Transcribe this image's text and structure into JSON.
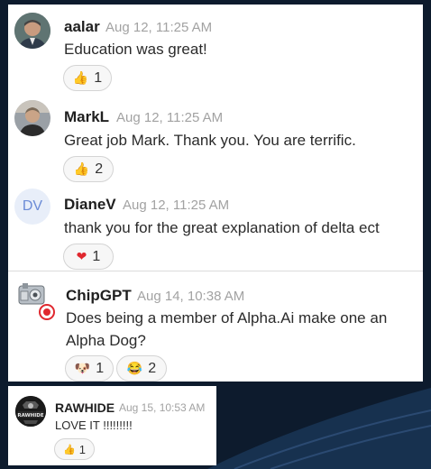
{
  "messages": [
    {
      "author": "aalar",
      "time": "Aug 12, 11:25 AM",
      "text": "Education was great!",
      "reactions": [
        {
          "icon": "thumbs-up",
          "count": "1"
        }
      ]
    },
    {
      "author": "MarkL",
      "time": "Aug 12, 11:25 AM",
      "text": "Great job Mark. Thank you. You are terrific.",
      "reactions": [
        {
          "icon": "thumbs-up",
          "count": "2"
        }
      ]
    },
    {
      "author": "DianeV",
      "initials": "DV",
      "time": "Aug 12, 11:25 AM",
      "text": "thank you for the great explanation of delta ect",
      "reactions": [
        {
          "icon": "red-heart",
          "count": "1"
        }
      ]
    },
    {
      "author": "ChipGPT",
      "time": "Aug 14, 10:38 AM",
      "text_line1": "Does being a member of Alpha.Ai make one an",
      "text_line2": "Alpha Dog?",
      "reactions": [
        {
          "icon": "dog-face",
          "count": "1"
        },
        {
          "icon": "joy-face",
          "count": "2"
        }
      ]
    },
    {
      "author": "RAWHIDE",
      "avatar_text": "RAWHIDE",
      "time": "Aug 15, 10:53 AM",
      "text": "LOVE IT !!!!!!!!!",
      "reactions": [
        {
          "icon": "thumbs-up",
          "count": "1"
        }
      ]
    }
  ],
  "colors": {
    "background": "#0d1b2d",
    "panel": "#ffffff",
    "timestamp": "#a2a2a2",
    "initials_avatar": "#e8eef9",
    "initials_text": "#6b8bd6",
    "ai_badge": "#e0282f"
  }
}
